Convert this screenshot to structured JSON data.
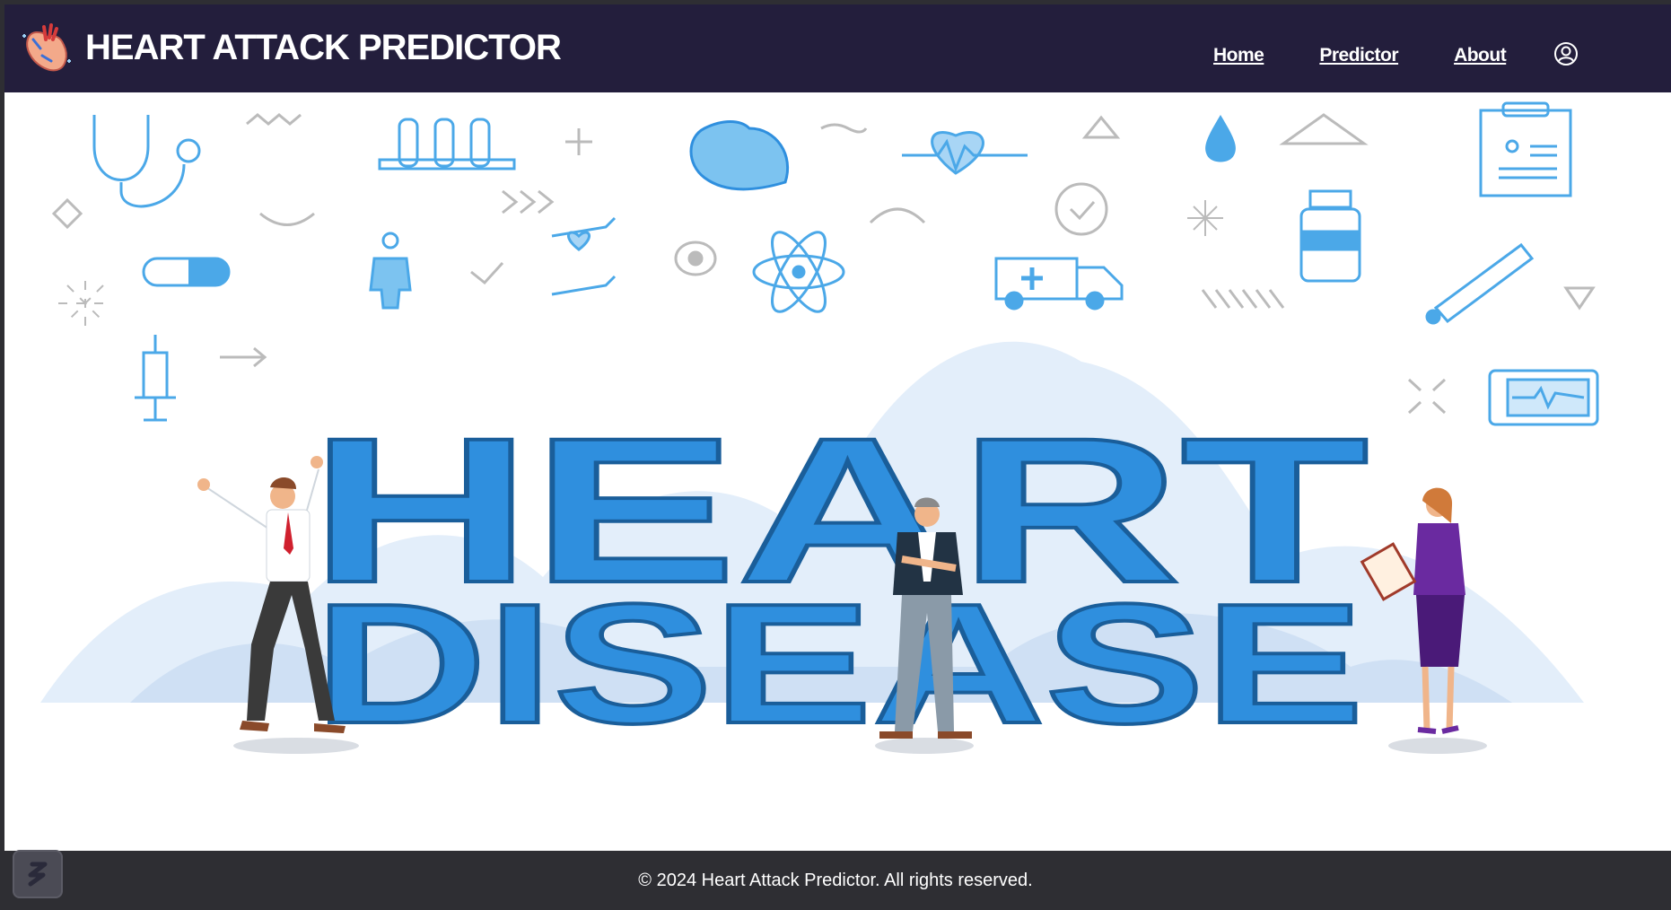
{
  "header": {
    "title": "HEART ATTACK PREDICTOR",
    "nav": [
      "Home",
      "Predictor",
      "About"
    ]
  },
  "icons": {
    "logo": "heart-anatomy-icon",
    "user": "user-circle-icon",
    "corner": "app-launcher-icon"
  },
  "hero": {
    "line1": "HEART",
    "line2": "DISEASE",
    "colors": {
      "accent": "#2f8fde",
      "outline": "#1a5e9a",
      "light": "#e3eefa",
      "icon": "#4ba8e8"
    }
  },
  "footer": {
    "text": "© 2024 Heart Attack Predictor. All rights reserved."
  }
}
